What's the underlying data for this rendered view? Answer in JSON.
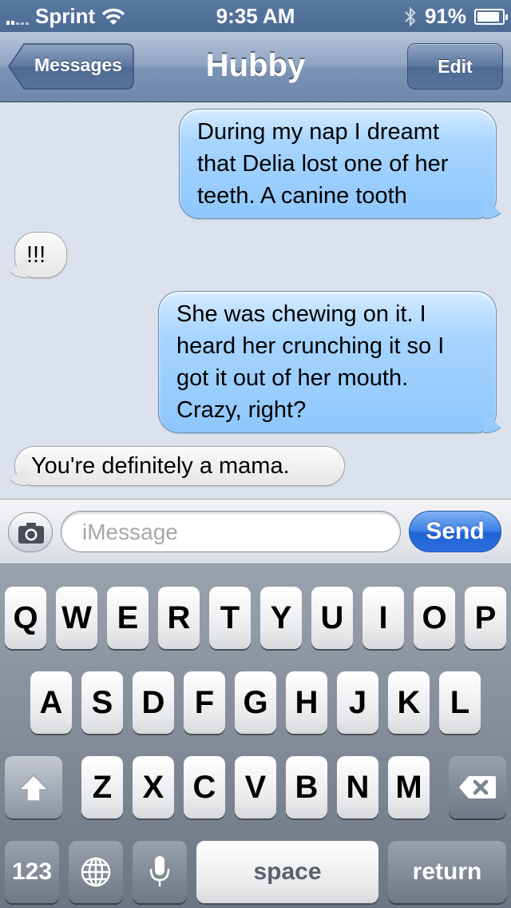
{
  "status_bar": {
    "carrier": "Sprint",
    "time": "9:35 AM",
    "battery": "91%",
    "battery_level": 0.91
  },
  "nav": {
    "back_label": "Messages",
    "title": "Hubby",
    "edit_label": "Edit"
  },
  "messages": [
    {
      "direction": "outgoing",
      "text": "During my nap I dreamt that Delia lost one of her teeth. A canine tooth"
    },
    {
      "direction": "incoming",
      "text": "!!!"
    },
    {
      "direction": "outgoing",
      "text": "She was chewing on it. I heard her crunching it so I got it out of her mouth. Crazy, right?"
    },
    {
      "direction": "incoming",
      "text": "You're definitely a mama."
    }
  ],
  "input": {
    "placeholder": "iMessage",
    "send_label": "Send",
    "camera_icon": "camera-icon"
  },
  "keyboard": {
    "row1": [
      "Q",
      "W",
      "E",
      "R",
      "T",
      "Y",
      "U",
      "I",
      "O",
      "P"
    ],
    "row2": [
      "A",
      "S",
      "D",
      "F",
      "G",
      "H",
      "J",
      "K",
      "L"
    ],
    "row3": [
      "Z",
      "X",
      "C",
      "V",
      "B",
      "N",
      "M"
    ],
    "numbers_label": "123",
    "space_label": "space",
    "return_label": "return"
  }
}
